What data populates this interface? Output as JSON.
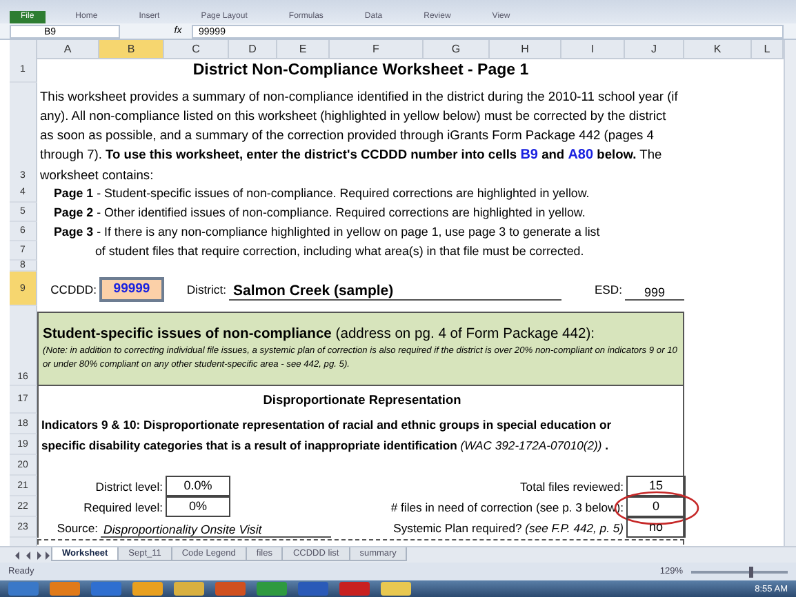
{
  "ribbon_tabs": [
    {
      "label": "File",
      "selected": false
    },
    {
      "label": "Home",
      "selected": false
    },
    {
      "label": "Insert",
      "selected": false
    },
    {
      "label": "Page Layout",
      "selected": false
    },
    {
      "label": "Formulas",
      "selected": false
    },
    {
      "label": "Data",
      "selected": false
    },
    {
      "label": "Review",
      "selected": false
    },
    {
      "label": "View",
      "selected": false
    }
  ],
  "formula_bar": {
    "name_box": "B9",
    "fx": "fx",
    "value": "99999"
  },
  "columns": [
    {
      "label": "A",
      "selected": false
    },
    {
      "label": "B",
      "selected": true
    },
    {
      "label": "C",
      "selected": false
    },
    {
      "label": "D",
      "selected": false
    },
    {
      "label": "E",
      "selected": false
    },
    {
      "label": "F",
      "selected": false
    },
    {
      "label": "G",
      "selected": false
    },
    {
      "label": "H",
      "selected": false
    },
    {
      "label": "I",
      "selected": false
    },
    {
      "label": "J",
      "selected": false
    },
    {
      "label": "K",
      "selected": false
    },
    {
      "label": "L",
      "selected": false
    }
  ],
  "sheet": {
    "title": {
      "row": "1",
      "text": "District Non-Compliance Worksheet - Page 1"
    },
    "intro": {
      "row": "3",
      "text": "This worksheet provides a summary of non-compliance identified in the district during the 2010-11 school year (if any).  All non-compliance listed on this worksheet (highlighted in yellow below) must be corrected by the district as soon as possible, and a  summary of the correction provided through iGrants Form Package 442 (pages 4 through 7).   **To use this worksheet, enter the district's CCDDD number into cells**",
      "refs": [
        "B9",
        "A80"
      ],
      "joiner": "and",
      "after": "below.",
      "tail": "The worksheet contains:"
    },
    "pages": [
      {
        "row": "4",
        "text": "**Page 1** - Student-specific issues of non-compliance.  Required corrections are highlighted in yellow."
      },
      {
        "row": "5",
        "text": "**Page 2** - Other identified issues of non-compliance.  Required corrections are highlighted in yellow."
      },
      {
        "row": "6",
        "text": "**Page 3** - If there is any non-compliance highlighted in yellow on page 1, use page 3 to generate a list"
      },
      {
        "row": "7",
        "text": "of student files that require correction, including what area(s) in that file must be corrected.",
        "kind": "continuation"
      }
    ],
    "blank_rows": [
      "8"
    ],
    "district": {
      "row": "9",
      "selected": true,
      "ccddd_label": "CCDDD:",
      "ccddd": "99999",
      "district_label": "District:",
      "district": "Salmon Creek (sample)",
      "esd_label": "ESD:",
      "esd": "999"
    },
    "section": {
      "row": "16",
      "title": "**Student-specific issues of non-compliance** (address on pg. 4 of Form Package 442):",
      "note": "(Note: in addition to correcting individual file issues, a systemic plan of correction is also required if the district is over 20% non-compliant on indicators 9 or 10 or under 80% compliant on any other student-specific area - see 442, pg. 5)."
    },
    "subheading": {
      "row": "17",
      "text": "Disproportionate Representation"
    },
    "indicator": [
      {
        "row": "18",
        "text": "**Indicators 9 & 10:  Disproportionate representation of racial and ethnic groups in special education or**"
      },
      {
        "row": "19",
        "text": "**specific disability categories that is a result of inappropriate identification** *(WAC 392-172A-07010(2))* **.**"
      }
    ],
    "blank_row": "20",
    "metrics": [
      {
        "row": "21",
        "left_label": "District level:",
        "left_value": "0.0%",
        "right_label": "Total files reviewed:",
        "right_value": "15",
        "circled": false
      },
      {
        "row": "22",
        "left_label": "Required level:",
        "left_value": "0%",
        "right_label": "# files in need of correction (see p. 3 below):",
        "right_value": "0",
        "circled": true
      }
    ],
    "source": {
      "row": "23",
      "label": "Source:",
      "value": "Disproportionality Onsite Visit",
      "right_label": "Systemic Plan required? *(see F.P. 442, p. 5)*",
      "right_value": "no"
    }
  },
  "sheet_tabs": [
    {
      "label": "Worksheet",
      "selected": true
    },
    {
      "label": "Sept_11",
      "selected": false
    },
    {
      "label": "Code Legend",
      "selected": false
    },
    {
      "label": "files",
      "selected": false
    },
    {
      "label": "CCDDD list",
      "selected": false
    },
    {
      "label": "summary",
      "selected": false
    }
  ],
  "status_bar": {
    "status": "Ready",
    "zoom": "129%",
    "level": 0.6
  },
  "taskbar": {
    "time": "8:55 AM"
  }
}
